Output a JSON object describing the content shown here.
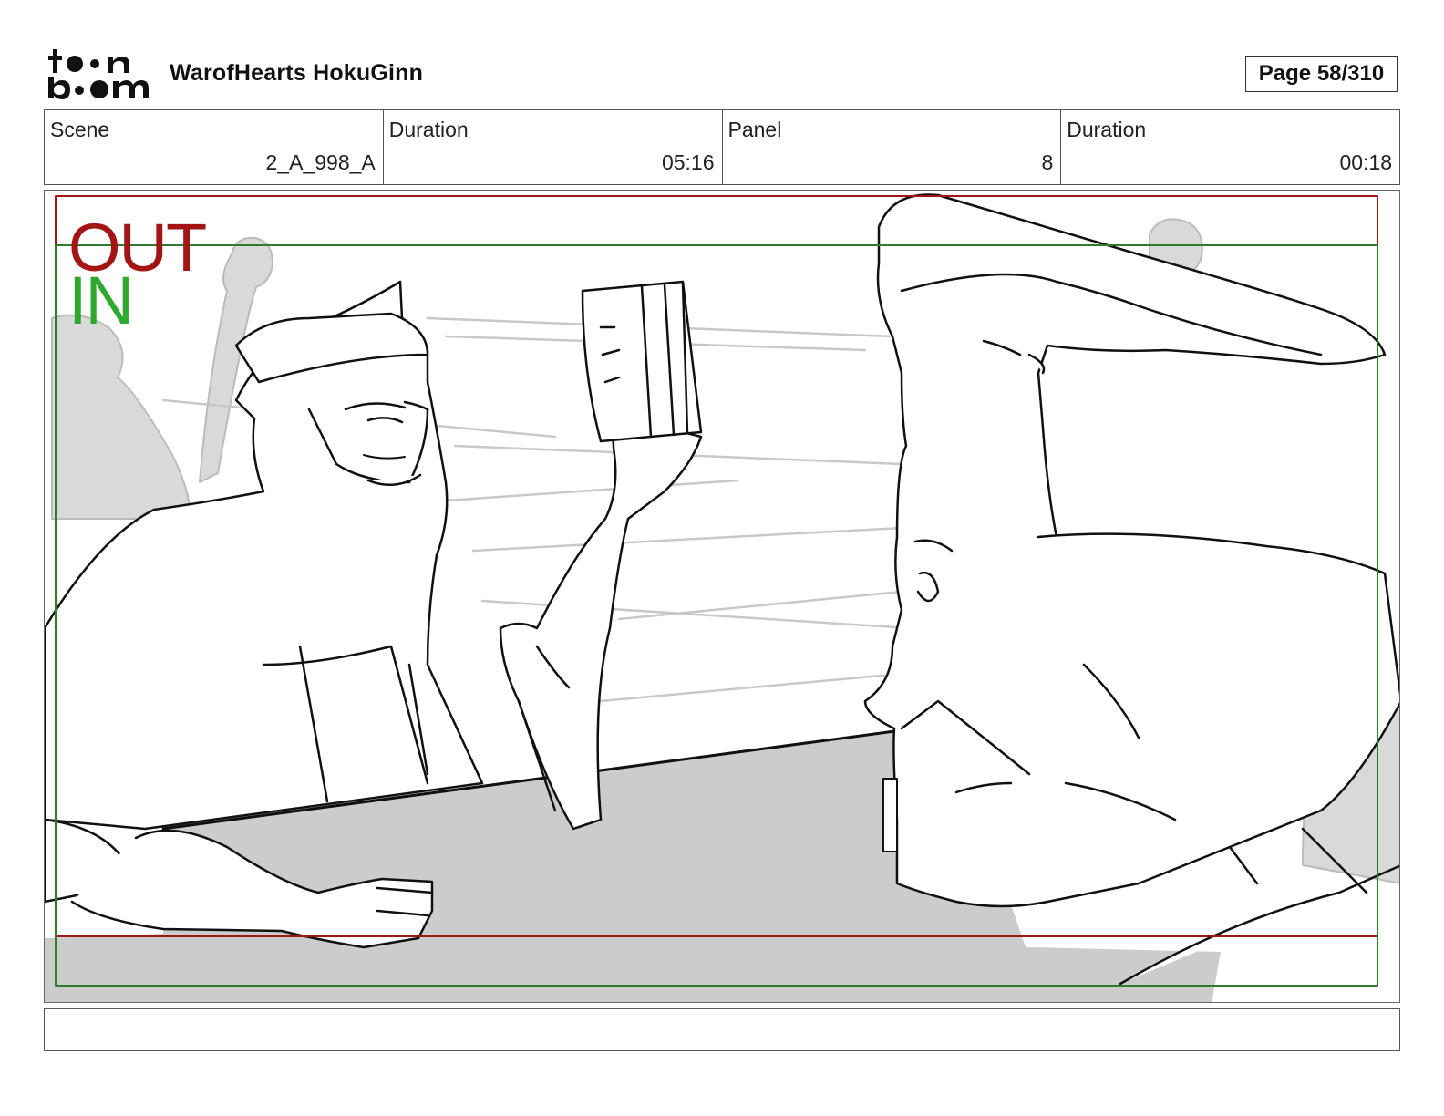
{
  "header": {
    "logo_text": "toon boom",
    "project_title": "WarofHearts HokuGinn",
    "page_label": "Page",
    "page_number": "58/310"
  },
  "info": [
    {
      "label": "Scene",
      "value": "2_A_998_A"
    },
    {
      "label": "Duration",
      "value": "05:16"
    },
    {
      "label": "Panel",
      "value": "8"
    },
    {
      "label": "Duration",
      "value": "00:18"
    }
  ],
  "panel": {
    "out_label": "OUT",
    "in_label": "IN",
    "colors": {
      "out_frame": "#a31515",
      "in_frame": "#2e7d2e",
      "table_fill": "#cccccc",
      "background_fill": "#d9d9d9"
    }
  },
  "dialogue": {
    "text": ""
  }
}
